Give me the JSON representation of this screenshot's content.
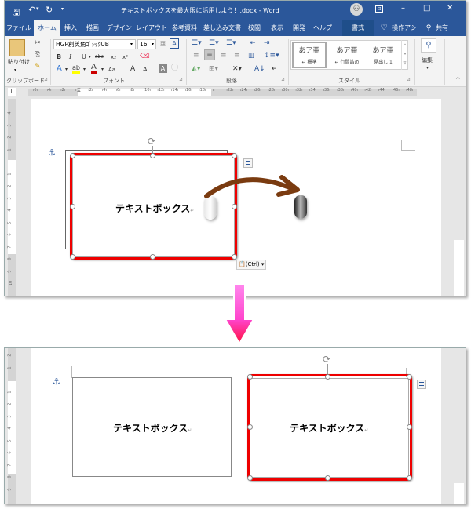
{
  "window": {
    "doc_title": "テキストボックスを最大限に活用しよう！.docx - Word",
    "quick_access": {
      "save": "save-icon",
      "undo": "undo-icon",
      "redo": "redo-icon",
      "customize": "▾"
    },
    "controls": {
      "account": "account-icon",
      "ribbon_display": "ribbon-display-icon",
      "minimize": "–",
      "maximize": "□",
      "close": "✕"
    }
  },
  "tabs": [
    {
      "label": "ファイル"
    },
    {
      "label": "ホーム",
      "active": true
    },
    {
      "label": "挿入"
    },
    {
      "label": "描画"
    },
    {
      "label": "デザイン"
    },
    {
      "label": "レイアウト"
    },
    {
      "label": "参考資料"
    },
    {
      "label": "差し込み文書"
    },
    {
      "label": "校閲"
    },
    {
      "label": "表示"
    },
    {
      "label": "開発"
    },
    {
      "label": "ヘルプ"
    },
    {
      "label": "書式",
      "contextual": true
    }
  ],
  "tell_me": "操作アシ",
  "share": "共有",
  "ribbon": {
    "clipboard": {
      "paste_label": "貼り付け",
      "group_label": "クリップボード"
    },
    "font": {
      "font_name": "HGP創英角ｺﾞｼｯｸUB",
      "font_size": "16",
      "group_label": "フォント",
      "bold": "B",
      "italic": "I",
      "underline": "U",
      "strike": "abc",
      "subscript": "x₂",
      "superscript": "x²",
      "change_case": "Aa",
      "grow": "A",
      "shrink": "A"
    },
    "paragraph": {
      "group_label": "段落"
    },
    "styles": {
      "group_label": "スタイル",
      "items": [
        {
          "sample": "あア亜",
          "name": "↵ 標準"
        },
        {
          "sample": "あア亜",
          "name": "↵ 行間詰め"
        },
        {
          "sample": "あア亜",
          "name": "見出し 1"
        }
      ]
    },
    "editing": {
      "label": "編集"
    }
  },
  "ruler": {
    "ticks": [
      "6",
      "4",
      "2",
      "",
      "2",
      "4",
      "6",
      "8",
      "10",
      "12",
      "14",
      "16",
      "18",
      "",
      "22",
      "24",
      "26",
      "28",
      "30",
      "32",
      "34",
      "36",
      "38",
      "40",
      "42",
      "44",
      "46",
      "48"
    ],
    "vertical_ticks_top": [
      "4",
      "3",
      "2",
      "1",
      "",
      "1",
      "2",
      "3",
      "4",
      "5",
      "6",
      "7",
      "8",
      "9",
      "10"
    ],
    "vertical_ticks_bottom": [
      "2",
      "1",
      "",
      "1",
      "2",
      "3",
      "4",
      "5",
      "6",
      "7",
      "8",
      "9"
    ]
  },
  "before": {
    "textbox_text": "テキストボックス",
    "paste_options": "(Ctrl) ▾",
    "highlight_color": "#e00000",
    "arrow_color": "#7a3b10"
  },
  "after": {
    "original_text": "テキストボックス",
    "copy_text": "テキストボックス",
    "highlight_color": "#e00000"
  },
  "transition_arrow_color": "#ff44cc"
}
